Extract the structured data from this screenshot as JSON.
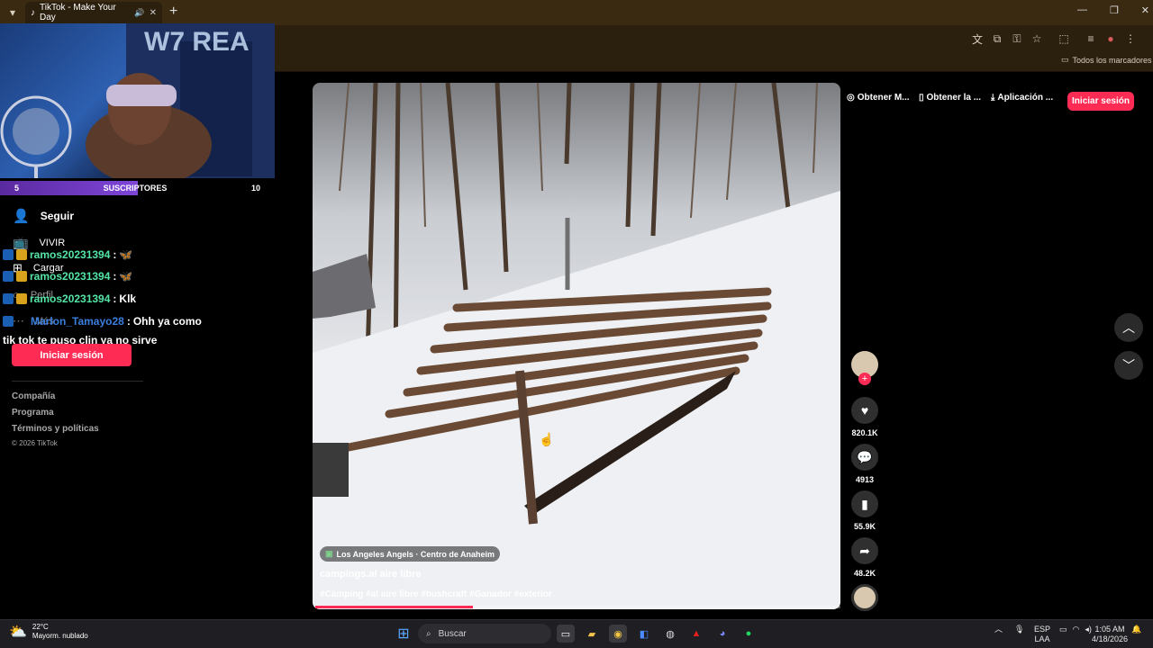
{
  "browser": {
    "tab_title": "TikTok - Make Your Day",
    "tab_add": "+",
    "bookmarks_label": "Todos los marcadores",
    "window_controls": [
      "minimize-icon",
      "restore-icon",
      "close-icon"
    ]
  },
  "stream_overlay": {
    "sub_left": "5",
    "sub_label": "SUSCRIPTORES",
    "sub_right": "10",
    "sub_progress_fraction": 0.5
  },
  "sidebar": {
    "nav": [
      {
        "label": "Seguir",
        "icon": "person-add-icon"
      },
      {
        "label": "VIVIR",
        "icon": "live-tv-icon"
      },
      {
        "label": "Cargar",
        "icon": "upload-icon"
      },
      {
        "label": "Perfil",
        "icon": "profile-icon"
      },
      {
        "label": "Más",
        "icon": "more-icon"
      }
    ],
    "login_button": "Iniciar sesión",
    "footer": {
      "company": "Compañía",
      "program": "Programa",
      "terms": "Términos y políticas",
      "copyright": "© 2026 TikTok"
    }
  },
  "chat": [
    {
      "user": "ramos20231394",
      "sep": " :",
      "text": "🦋"
    },
    {
      "user": "ramos20231394",
      "sep": " :",
      "text": "🦋"
    },
    {
      "user": "ramos20231394",
      "sep": " :",
      "text": " Klk"
    },
    {
      "user": "Marlon_Tamayo28",
      "sep": " :",
      "text": " Ohh ya como"
    }
  ],
  "chat_continuation": "tik tok te puso clin ya no sirve",
  "top_actions": {
    "get_m": "Obtener M...",
    "get_la": "Obtener la ...",
    "app": "Aplicación ...",
    "login": "Iniciar sesión"
  },
  "video": {
    "location": "Los Angeles Angels · Centro de Anaheim",
    "author": "campings.al aire libre",
    "hashtags": "#Cámping #al aire libre #bushcraft #Ganador #exterior",
    "progress_fraction": 0.3
  },
  "actions": {
    "likes": "820.1K",
    "comments": "4913",
    "saves": "55.9K",
    "shares": "48.2K"
  },
  "taskbar": {
    "weather_temp": "22°C",
    "weather_desc": "Mayorm. nublado",
    "search_placeholder": "Buscar",
    "lang_line1": "ESP",
    "lang_line2": "LAA",
    "time": "1:05 AM",
    "date": "4/18/2026"
  },
  "colors": {
    "accent": "#fe2c55",
    "chrome_bg": "#2b1f0e"
  }
}
